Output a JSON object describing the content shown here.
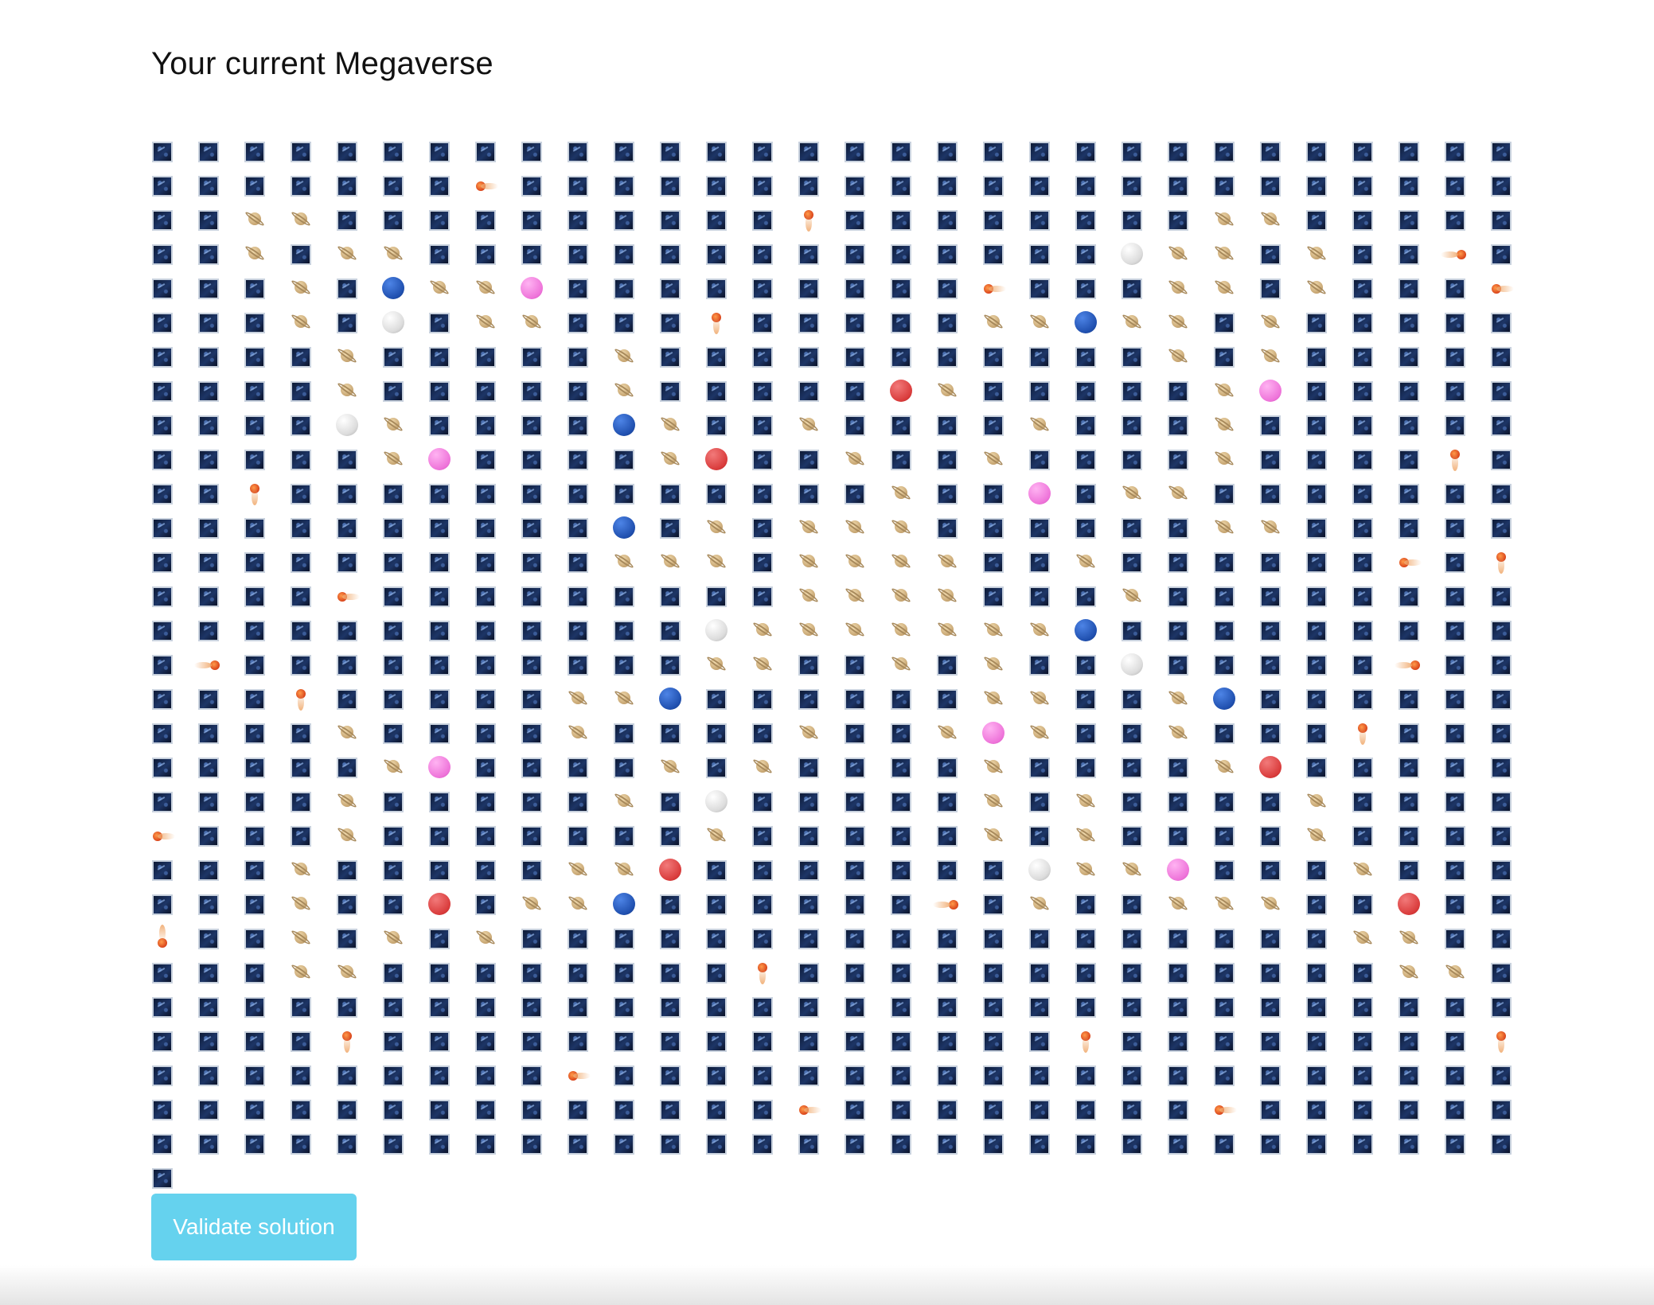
{
  "page": {
    "title": "Your current Megaverse",
    "validate_label": "Validate solution"
  },
  "colors": {
    "button": "#65d2ee",
    "soloon_blue": "#1f4fae",
    "soloon_red": "#d93b3b",
    "soloon_purple": "#ee73d9",
    "soloon_white": "#dcdcdc"
  },
  "legend": {
    "_": "space",
    "P": "polyanet",
    "B": "blue soloon",
    "R": "red soloon",
    "U": "purple soloon",
    "W": "white soloon",
    "<": "cometh left",
    ">": "cometh right",
    "^": "cometh up",
    "v": "cometh down"
  },
  "map": [
    "______________________________",
    "_______<______________________",
    "__PP__________^________PP_____",
    "__P_PP_______________WPP_P__>_",
    "___P_BPPU_________<___PP_P___<",
    "___P_W_PP___^_____PPBPP_P_____",
    "____P_____P___________P_P_____",
    "____P_____P_____RP_____PU_____",
    "____WP____BP__P____P___P______",
    "_____PU____PR__P__P____P____^_",
    "__^_____________P__U_PP_______",
    "__________B_P_PPP______PP_____",
    "__________PPP_PPPP__P______<_^",
    "____<_________PPPP___P________",
    "____________WPPPPPPPB_________",
    "_>__________PP__P_P__W_____>__",
    "___^_____PPB______PP__PB______",
    "____P____P____P__PUP__P___^___",
    "_____PU____P_P____P____PR_____",
    "____P_____P_W_____P_P____P____",
    "<___P_______P_____P_P____P____",
    "___P_____PPR_______WPPU___P___",
    "___P__R_PPB______>_P__PPP__R__v",
    "__P_P_P__________________PP___",
    "__PP________^_____________PP__",
    "______________________________",
    "___^_______________^________^_",
    "________<_____________________",
    "_____________<________<_______",
    "______________________________"
  ]
}
